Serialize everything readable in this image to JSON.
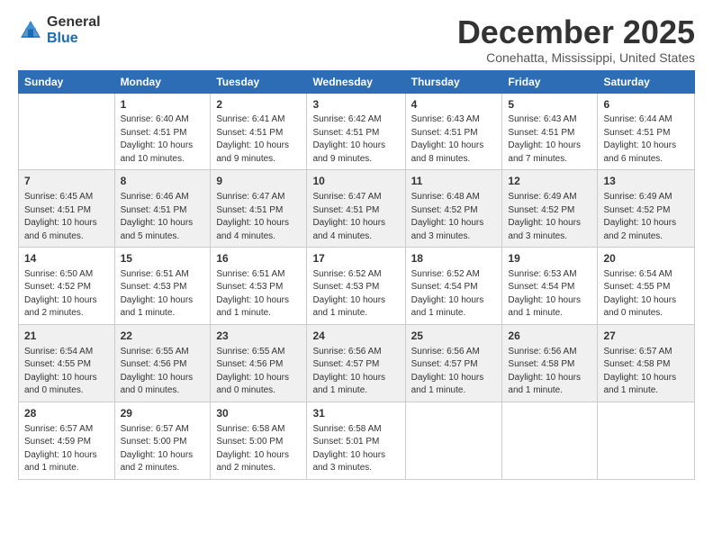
{
  "logo": {
    "general": "General",
    "blue": "Blue"
  },
  "title": "December 2025",
  "location": "Conehatta, Mississippi, United States",
  "weekdays": [
    "Sunday",
    "Monday",
    "Tuesday",
    "Wednesday",
    "Thursday",
    "Friday",
    "Saturday"
  ],
  "rows": [
    [
      {
        "day": "",
        "info": ""
      },
      {
        "day": "1",
        "info": "Sunrise: 6:40 AM\nSunset: 4:51 PM\nDaylight: 10 hours\nand 10 minutes."
      },
      {
        "day": "2",
        "info": "Sunrise: 6:41 AM\nSunset: 4:51 PM\nDaylight: 10 hours\nand 9 minutes."
      },
      {
        "day": "3",
        "info": "Sunrise: 6:42 AM\nSunset: 4:51 PM\nDaylight: 10 hours\nand 9 minutes."
      },
      {
        "day": "4",
        "info": "Sunrise: 6:43 AM\nSunset: 4:51 PM\nDaylight: 10 hours\nand 8 minutes."
      },
      {
        "day": "5",
        "info": "Sunrise: 6:43 AM\nSunset: 4:51 PM\nDaylight: 10 hours\nand 7 minutes."
      },
      {
        "day": "6",
        "info": "Sunrise: 6:44 AM\nSunset: 4:51 PM\nDaylight: 10 hours\nand 6 minutes."
      }
    ],
    [
      {
        "day": "7",
        "info": "Sunrise: 6:45 AM\nSunset: 4:51 PM\nDaylight: 10 hours\nand 6 minutes."
      },
      {
        "day": "8",
        "info": "Sunrise: 6:46 AM\nSunset: 4:51 PM\nDaylight: 10 hours\nand 5 minutes."
      },
      {
        "day": "9",
        "info": "Sunrise: 6:47 AM\nSunset: 4:51 PM\nDaylight: 10 hours\nand 4 minutes."
      },
      {
        "day": "10",
        "info": "Sunrise: 6:47 AM\nSunset: 4:51 PM\nDaylight: 10 hours\nand 4 minutes."
      },
      {
        "day": "11",
        "info": "Sunrise: 6:48 AM\nSunset: 4:52 PM\nDaylight: 10 hours\nand 3 minutes."
      },
      {
        "day": "12",
        "info": "Sunrise: 6:49 AM\nSunset: 4:52 PM\nDaylight: 10 hours\nand 3 minutes."
      },
      {
        "day": "13",
        "info": "Sunrise: 6:49 AM\nSunset: 4:52 PM\nDaylight: 10 hours\nand 2 minutes."
      }
    ],
    [
      {
        "day": "14",
        "info": "Sunrise: 6:50 AM\nSunset: 4:52 PM\nDaylight: 10 hours\nand 2 minutes."
      },
      {
        "day": "15",
        "info": "Sunrise: 6:51 AM\nSunset: 4:53 PM\nDaylight: 10 hours\nand 1 minute."
      },
      {
        "day": "16",
        "info": "Sunrise: 6:51 AM\nSunset: 4:53 PM\nDaylight: 10 hours\nand 1 minute."
      },
      {
        "day": "17",
        "info": "Sunrise: 6:52 AM\nSunset: 4:53 PM\nDaylight: 10 hours\nand 1 minute."
      },
      {
        "day": "18",
        "info": "Sunrise: 6:52 AM\nSunset: 4:54 PM\nDaylight: 10 hours\nand 1 minute."
      },
      {
        "day": "19",
        "info": "Sunrise: 6:53 AM\nSunset: 4:54 PM\nDaylight: 10 hours\nand 1 minute."
      },
      {
        "day": "20",
        "info": "Sunrise: 6:54 AM\nSunset: 4:55 PM\nDaylight: 10 hours\nand 0 minutes."
      }
    ],
    [
      {
        "day": "21",
        "info": "Sunrise: 6:54 AM\nSunset: 4:55 PM\nDaylight: 10 hours\nand 0 minutes."
      },
      {
        "day": "22",
        "info": "Sunrise: 6:55 AM\nSunset: 4:56 PM\nDaylight: 10 hours\nand 0 minutes."
      },
      {
        "day": "23",
        "info": "Sunrise: 6:55 AM\nSunset: 4:56 PM\nDaylight: 10 hours\nand 0 minutes."
      },
      {
        "day": "24",
        "info": "Sunrise: 6:56 AM\nSunset: 4:57 PM\nDaylight: 10 hours\nand 1 minute."
      },
      {
        "day": "25",
        "info": "Sunrise: 6:56 AM\nSunset: 4:57 PM\nDaylight: 10 hours\nand 1 minute."
      },
      {
        "day": "26",
        "info": "Sunrise: 6:56 AM\nSunset: 4:58 PM\nDaylight: 10 hours\nand 1 minute."
      },
      {
        "day": "27",
        "info": "Sunrise: 6:57 AM\nSunset: 4:58 PM\nDaylight: 10 hours\nand 1 minute."
      }
    ],
    [
      {
        "day": "28",
        "info": "Sunrise: 6:57 AM\nSunset: 4:59 PM\nDaylight: 10 hours\nand 1 minute."
      },
      {
        "day": "29",
        "info": "Sunrise: 6:57 AM\nSunset: 5:00 PM\nDaylight: 10 hours\nand 2 minutes."
      },
      {
        "day": "30",
        "info": "Sunrise: 6:58 AM\nSunset: 5:00 PM\nDaylight: 10 hours\nand 2 minutes."
      },
      {
        "day": "31",
        "info": "Sunrise: 6:58 AM\nSunset: 5:01 PM\nDaylight: 10 hours\nand 3 minutes."
      },
      {
        "day": "",
        "info": ""
      },
      {
        "day": "",
        "info": ""
      },
      {
        "day": "",
        "info": ""
      }
    ]
  ]
}
